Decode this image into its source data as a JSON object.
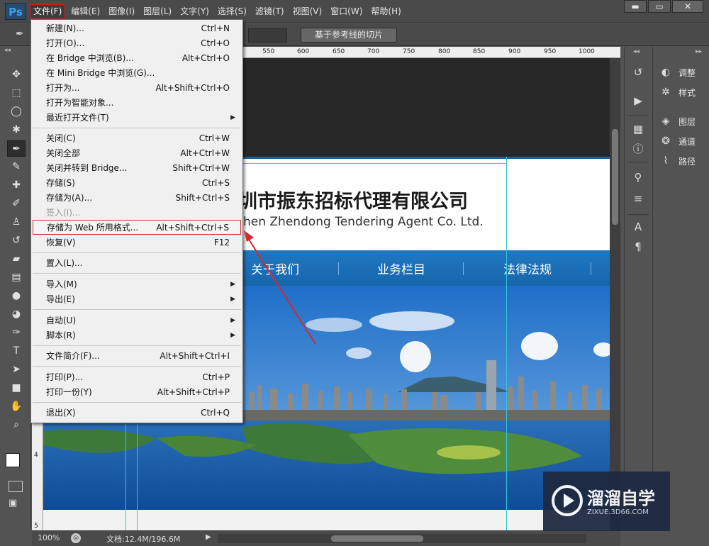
{
  "app": {
    "logo": "Ps"
  },
  "menubar": {
    "items": [
      "文件(F)",
      "编辑(E)",
      "图像(I)",
      "图层(L)",
      "文字(Y)",
      "选择(S)",
      "滤镜(T)",
      "视图(V)",
      "窗口(W)",
      "帮助(H)"
    ],
    "active": "文件(F)"
  },
  "window_controls": {
    "minimize": "▬",
    "maximize": "▭",
    "close": "✕"
  },
  "options_bar": {
    "tool_icon": "slice-tool-icon",
    "slice_button": "基于参考线的切片"
  },
  "ruler_top": [
    "550",
    "600",
    "650",
    "700",
    "750",
    "800",
    "850",
    "900",
    "950",
    "1000"
  ],
  "ruler_left": [
    "4",
    "5"
  ],
  "canvas": {
    "company_cn": "圳市振东招标代理有限公司",
    "company_en": "hen Zhendong Tendering Agent Co. Ltd.",
    "nav": [
      "关于我们",
      "业务栏目",
      "法律法规"
    ],
    "nav_color": "#1f78c2"
  },
  "status_bar": {
    "zoom": "100%",
    "doc_info": "文档:12.4M/196.6M"
  },
  "panels": {
    "dock2": [
      {
        "icon": "adjustments-icon",
        "label": "调整"
      },
      {
        "icon": "styles-icon",
        "label": "样式"
      },
      {
        "icon": "layers-icon",
        "label": "图层"
      },
      {
        "icon": "channels-icon",
        "label": "通道"
      },
      {
        "icon": "paths-icon",
        "label": "路径"
      }
    ]
  },
  "file_menu": {
    "items": [
      {
        "label": "新建(N)...",
        "shortcut": "Ctrl+N"
      },
      {
        "label": "打开(O)...",
        "shortcut": "Ctrl+O"
      },
      {
        "label": "在 Bridge 中浏览(B)...",
        "shortcut": "Alt+Ctrl+O"
      },
      {
        "label": "在 Mini Bridge 中浏览(G)...",
        "shortcut": ""
      },
      {
        "label": "打开为...",
        "shortcut": "Alt+Shift+Ctrl+O"
      },
      {
        "label": "打开为智能对象...",
        "shortcut": ""
      },
      {
        "label": "最近打开文件(T)",
        "shortcut": "",
        "submenu": true
      },
      {
        "label": "关闭(C)",
        "shortcut": "Ctrl+W"
      },
      {
        "label": "关闭全部",
        "shortcut": "Alt+Ctrl+W"
      },
      {
        "label": "关闭并转到 Bridge...",
        "shortcut": "Shift+Ctrl+W"
      },
      {
        "label": "存储(S)",
        "shortcut": "Ctrl+S"
      },
      {
        "label": "存储为(A)...",
        "shortcut": "Shift+Ctrl+S"
      },
      {
        "label": "签入(I)...",
        "shortcut": "",
        "disabled": true
      },
      {
        "label": "存储为 Web 所用格式...",
        "shortcut": "Alt+Shift+Ctrl+S",
        "highlighted": true
      },
      {
        "label": "恢复(V)",
        "shortcut": "F12"
      },
      {
        "label": "置入(L)...",
        "shortcut": ""
      },
      {
        "label": "导入(M)",
        "shortcut": "",
        "submenu": true
      },
      {
        "label": "导出(E)",
        "shortcut": "",
        "submenu": true
      },
      {
        "label": "自动(U)",
        "shortcut": "",
        "submenu": true
      },
      {
        "label": "脚本(R)",
        "shortcut": "",
        "submenu": true
      },
      {
        "label": "文件简介(F)...",
        "shortcut": "Alt+Shift+Ctrl+I"
      },
      {
        "label": "打印(P)...",
        "shortcut": "Ctrl+P"
      },
      {
        "label": "打印一份(Y)",
        "shortcut": "Alt+Shift+Ctrl+P"
      },
      {
        "label": "退出(X)",
        "shortcut": "Ctrl+Q"
      }
    ]
  },
  "watermark": {
    "title": "溜溜自学",
    "url": "ZIXUE.3D66.COM"
  }
}
